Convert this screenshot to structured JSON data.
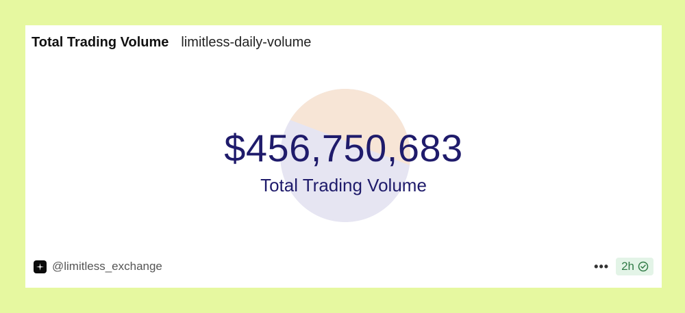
{
  "header": {
    "title": "Total Trading Volume",
    "query_name": "limitless-daily-volume"
  },
  "counter": {
    "value": "$456,750,683",
    "label": "Total Trading Volume"
  },
  "footer": {
    "author": "@limitless_exchange",
    "more_label": "•••",
    "refresh_age": "2h",
    "refresh_icon": "check-circle-icon"
  },
  "colors": {
    "page_background": "#e6f8a0",
    "card_background": "#ffffff",
    "counter_text": "#1f1b6b",
    "badge_background": "#e3f4e7",
    "badge_text": "#2f7a45",
    "watermark_top": "#f7e5d6",
    "watermark_bottom": "#e6e5f2"
  }
}
